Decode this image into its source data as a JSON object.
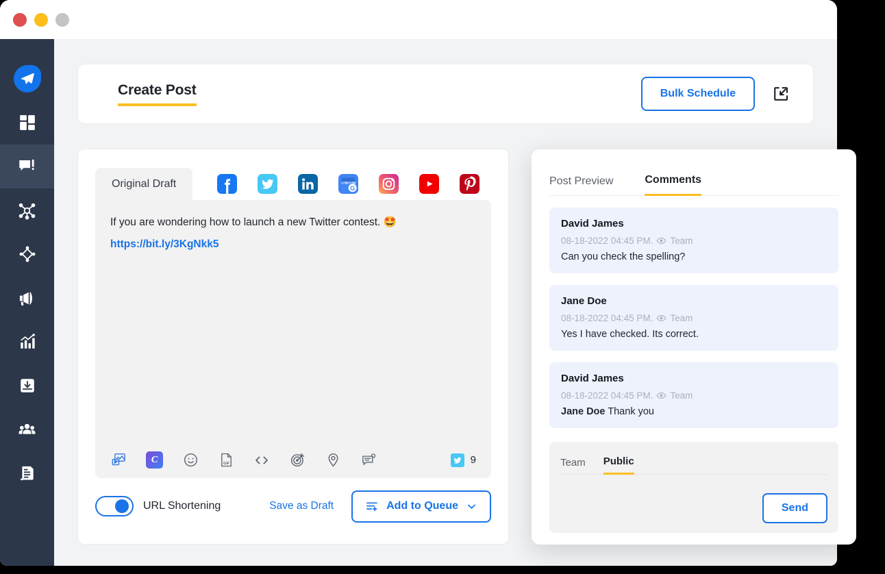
{
  "window": {
    "traffic_lights": [
      "close",
      "minimize",
      "maximize"
    ]
  },
  "sidebar": {
    "items": [
      {
        "name": "logo",
        "icon": "paper-plane-icon",
        "active": false
      },
      {
        "name": "dashboard",
        "icon": "grid-icon",
        "active": false
      },
      {
        "name": "publish",
        "icon": "compose-message-icon",
        "active": true
      },
      {
        "name": "engage",
        "icon": "network-nodes-icon",
        "active": false
      },
      {
        "name": "discovery",
        "icon": "diamond-nodes-icon",
        "active": false
      },
      {
        "name": "campaigns",
        "icon": "megaphone-icon",
        "active": false
      },
      {
        "name": "analytics",
        "icon": "bar-chart-icon",
        "active": false
      },
      {
        "name": "inbox",
        "icon": "download-tray-icon",
        "active": false
      },
      {
        "name": "team",
        "icon": "people-icon",
        "active": false
      },
      {
        "name": "reports",
        "icon": "document-report-icon",
        "active": false
      }
    ]
  },
  "header": {
    "title": "Create Post",
    "bulk_schedule_label": "Bulk Schedule",
    "expand_icon": "expand-collapse-icon"
  },
  "composer": {
    "draft_tab_label": "Original Draft",
    "social_tabs": [
      {
        "name": "facebook",
        "label": "Facebook"
      },
      {
        "name": "twitter",
        "label": "Twitter"
      },
      {
        "name": "linkedin",
        "label": "LinkedIn"
      },
      {
        "name": "google-business",
        "label": "Google Business Profile"
      },
      {
        "name": "instagram",
        "label": "Instagram"
      },
      {
        "name": "youtube",
        "label": "YouTube"
      },
      {
        "name": "pinterest",
        "label": "Pinterest"
      }
    ],
    "post_text": "If you are wondering how to launch a new Twitter contest.  🤩",
    "post_link": "https://bit.ly/3KgNkk5",
    "toolbar": [
      {
        "name": "media-icon",
        "label": "Add media"
      },
      {
        "name": "canva-icon",
        "label": "C"
      },
      {
        "name": "emoji-icon",
        "label": "Emoji"
      },
      {
        "name": "gif-icon",
        "label": "GIF"
      },
      {
        "name": "code-icon",
        "label": "Code"
      },
      {
        "name": "target-icon",
        "label": "Targeting"
      },
      {
        "name": "location-icon",
        "label": "Location"
      },
      {
        "name": "note-icon",
        "label": "Note"
      }
    ],
    "char_count": "9",
    "char_count_network": "twitter",
    "url_shortening_label": "URL Shortening",
    "url_shortening_on": true,
    "save_draft_label": "Save as Draft",
    "add_to_queue_label": "Add to Queue"
  },
  "comments_panel": {
    "tabs": [
      {
        "label": "Post Preview",
        "active": false
      },
      {
        "label": "Comments",
        "active": true
      }
    ],
    "comments": [
      {
        "author": "David James",
        "timestamp": "08-18-2022 04:45 PM.",
        "visibility": "Team",
        "mention": "",
        "text": "Can you check the spelling?"
      },
      {
        "author": "Jane Doe",
        "timestamp": "08-18-2022 04:45 PM.",
        "visibility": "Team",
        "mention": "",
        "text": "Yes I have checked. Its correct."
      },
      {
        "author": "David James",
        "timestamp": "08-18-2022 04:45 PM.",
        "visibility": "Team",
        "mention": "Jane Doe",
        "text": "Thank you"
      }
    ],
    "reply": {
      "tabs": [
        {
          "label": "Team",
          "active": false
        },
        {
          "label": "Public",
          "active": true
        }
      ],
      "send_label": "Send"
    }
  },
  "colors": {
    "accent_blue": "#1a73e8",
    "accent_yellow": "#fcbe20",
    "sidebar": "#2c374a",
    "sidebar_active": "#3b475c",
    "comment_bg": "#eef2fd",
    "canvas_bg": "#f2f3f4"
  }
}
